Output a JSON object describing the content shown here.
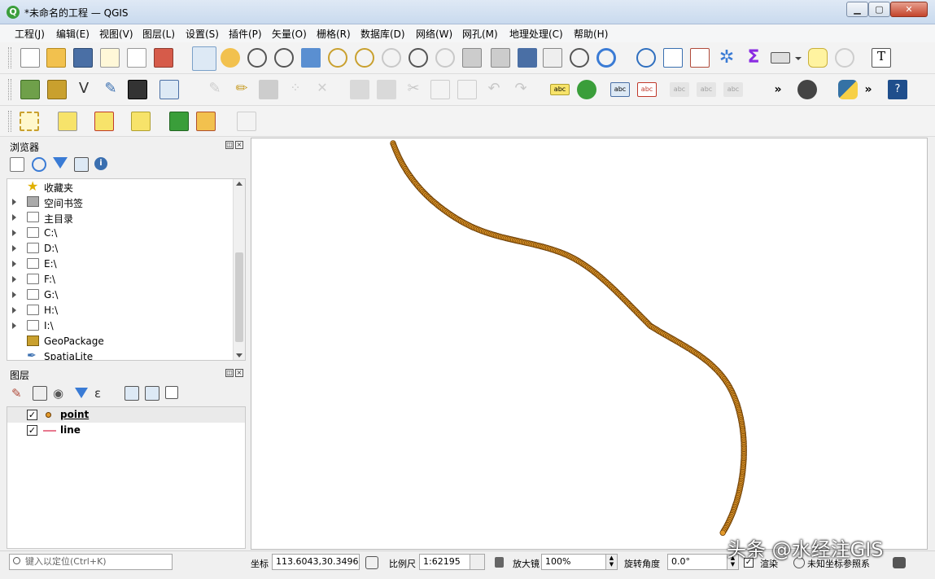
{
  "window": {
    "title": "*未命名的工程 — QGIS",
    "app_icon": "Q"
  },
  "menu": [
    "工程(J)",
    "编辑(E)",
    "视图(V)",
    "图层(L)",
    "设置(S)",
    "插件(P)",
    "矢量(O)",
    "栅格(R)",
    "数据库(D)",
    "网络(W)",
    "网孔(M)",
    "地理处理(C)",
    "帮助(H)"
  ],
  "toolbar": {
    "more1": "»",
    "more2": "»",
    "label_abc": "abc"
  },
  "browser": {
    "title": "浏览器",
    "items": [
      {
        "label": "收藏夹",
        "icon": "star-icon",
        "expandable": false
      },
      {
        "label": "空间书签",
        "icon": "bookmark-icon",
        "expandable": true
      },
      {
        "label": "主目录",
        "icon": "home-folder-icon",
        "expandable": true
      },
      {
        "label": "C:\\",
        "icon": "folder-icon",
        "expandable": true
      },
      {
        "label": "D:\\",
        "icon": "folder-icon",
        "expandable": true
      },
      {
        "label": "E:\\",
        "icon": "folder-icon",
        "expandable": true
      },
      {
        "label": "F:\\",
        "icon": "folder-icon",
        "expandable": true
      },
      {
        "label": "G:\\",
        "icon": "folder-icon",
        "expandable": true
      },
      {
        "label": "H:\\",
        "icon": "folder-icon",
        "expandable": true
      },
      {
        "label": "I:\\",
        "icon": "folder-icon",
        "expandable": true
      },
      {
        "label": "GeoPackage",
        "icon": "geopackage-icon",
        "expandable": false
      },
      {
        "label": "SpatiaLite",
        "icon": "spatialite-icon",
        "expandable": false
      }
    ]
  },
  "layers": {
    "title": "图层",
    "items": [
      {
        "name": "point",
        "checked": true,
        "symbol": "point-symbol-icon"
      },
      {
        "name": "line",
        "checked": true,
        "symbol": "line-symbol-icon"
      }
    ]
  },
  "map": {
    "point_fill": "#e39a2b",
    "point_stroke": "#6b3d05",
    "line_color": "#e8798f"
  },
  "status": {
    "locator_placeholder": "键入以定位(Ctrl+K)",
    "coord_label": "坐标",
    "coord_value": "113.6043,30.3496",
    "scale_label": "比例尺",
    "scale_value": "1:62195",
    "magnifier_label": "放大镜",
    "magnifier_value": "100%",
    "rotation_label": "旋转角度",
    "rotation_value": "0.0°",
    "render_label": "渲染",
    "crs_label": "未知坐标参照系"
  },
  "watermark": "头条 @水经注GIS"
}
